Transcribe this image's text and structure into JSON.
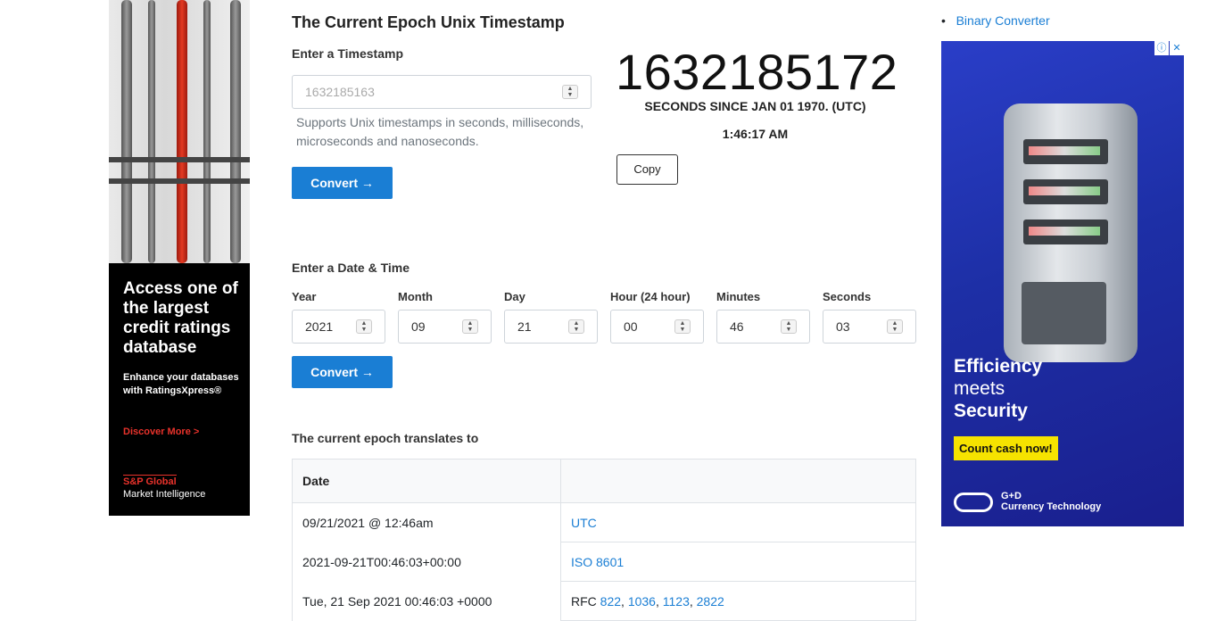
{
  "left_ad": {
    "headline": "Access one of the largest credit ratings database",
    "sub": "Enhance your databases with RatingsXpress®",
    "cta": "Discover More >",
    "brand_line1": "S&P Global",
    "brand_line2": "Market Intelligence"
  },
  "main": {
    "title": "The Current Epoch Unix Timestamp",
    "timestamp_label": "Enter a Timestamp",
    "timestamp_placeholder": "1632185163",
    "timestamp_help": "Supports Unix timestamps in seconds, milliseconds, microseconds and nanoseconds.",
    "convert_label": "Convert →",
    "current_timestamp": "1632185172",
    "seconds_since": "SECONDS SINCE JAN 01 1970. (UTC)",
    "current_time": "1:46:17 AM",
    "copy_label": "Copy",
    "date_time_label": "Enter a Date & Time",
    "fields": [
      {
        "label": "Year",
        "value": "2021"
      },
      {
        "label": "Month",
        "value": "09"
      },
      {
        "label": "Day",
        "value": "21"
      },
      {
        "label": "Hour (24 hour)",
        "value": "00"
      },
      {
        "label": "Minutes",
        "value": "46"
      },
      {
        "label": "Seconds",
        "value": "03"
      }
    ],
    "convert2_label": "Convert →",
    "translates_label": "The current epoch translates to",
    "table": {
      "header_date": "Date",
      "header_format": "",
      "rows": [
        {
          "date": "09/21/2021 @ 12:46am",
          "format": "UTC"
        },
        {
          "date": "2021-09-21T00:46:03+00:00",
          "format": "ISO 8601"
        },
        {
          "date": "Tue, 21 Sep 2021 00:46:03 +0000",
          "format_prefix": "RFC",
          "rfc_links": [
            "822",
            "1036",
            "1123",
            "2822"
          ]
        }
      ]
    }
  },
  "sidebar": {
    "bullet_link": "Binary Converter"
  },
  "right_ad": {
    "headline_1": "Efficiency",
    "headline_2": "meets",
    "headline_3": "Security",
    "cta": "Count cash now!",
    "logo_line1": "G+D",
    "logo_line2": "Currency Technology",
    "info_icon": "ⓘ",
    "close_icon": "✕"
  },
  "colors": {
    "accent": "#1a7ed4",
    "ad_yellow": "#f6e300",
    "ad_blue": "#1d2fa6",
    "brand_red": "#e8322b"
  }
}
